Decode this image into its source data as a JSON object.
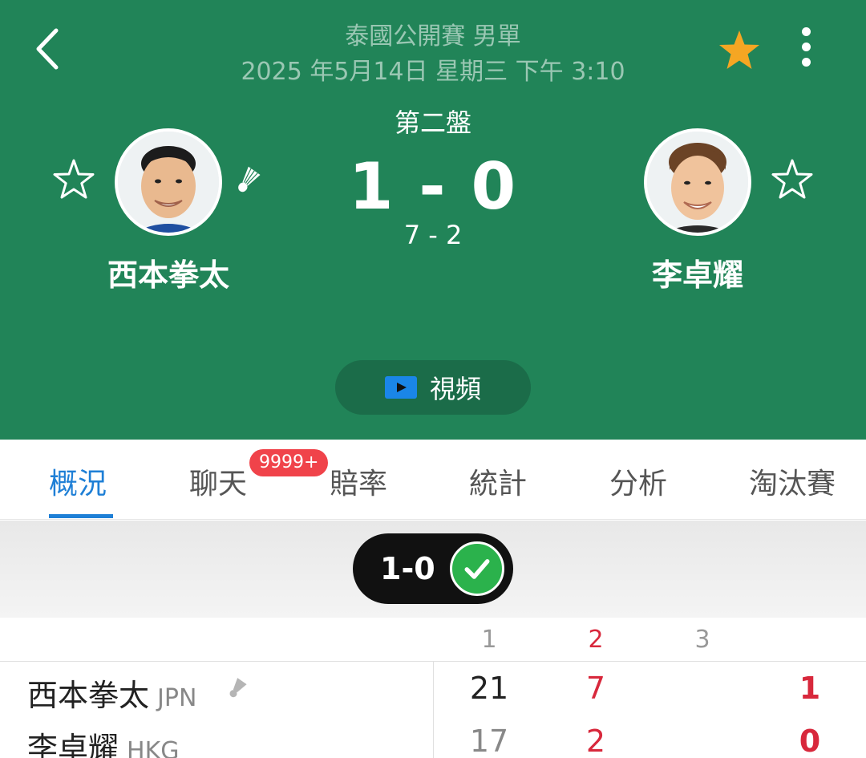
{
  "header": {
    "competition": "泰國公開賽 男單",
    "datetime": "2025 年5月14日 星期三 下午 3:10",
    "set_label": "第二盤",
    "sets_score": "1 - 0",
    "current_game_score": "7 - 2",
    "video_label": "視頻",
    "favorite_active_color": "#F5A623"
  },
  "players": {
    "left": {
      "name": "西本拳太",
      "serving": true
    },
    "right": {
      "name": "李卓耀",
      "serving": false
    }
  },
  "tabs": [
    {
      "label": "概況",
      "active": true
    },
    {
      "label": "聊天",
      "badge": "9999+"
    },
    {
      "label": "賠率"
    },
    {
      "label": "統計"
    },
    {
      "label": "分析"
    },
    {
      "label": "淘汰賽"
    }
  ],
  "result": {
    "label": "1-0",
    "status_icon": "check-icon"
  },
  "score_table": {
    "set_headers": [
      "1",
      "2",
      "3"
    ],
    "rows": [
      {
        "name": "西本拳太",
        "country": "JPN",
        "set1": "21",
        "set2": "7",
        "set3": "",
        "total": "1"
      },
      {
        "name": "李卓耀",
        "country": "HKG",
        "set1": "17",
        "set2": "2",
        "set3": "",
        "total": "0"
      }
    ]
  },
  "colors": {
    "header_bg": "#218458",
    "accent_blue": "#1E7FD6",
    "badge_red": "#F0434A",
    "live_red": "#D8283C",
    "check_green": "#2BB24C"
  }
}
